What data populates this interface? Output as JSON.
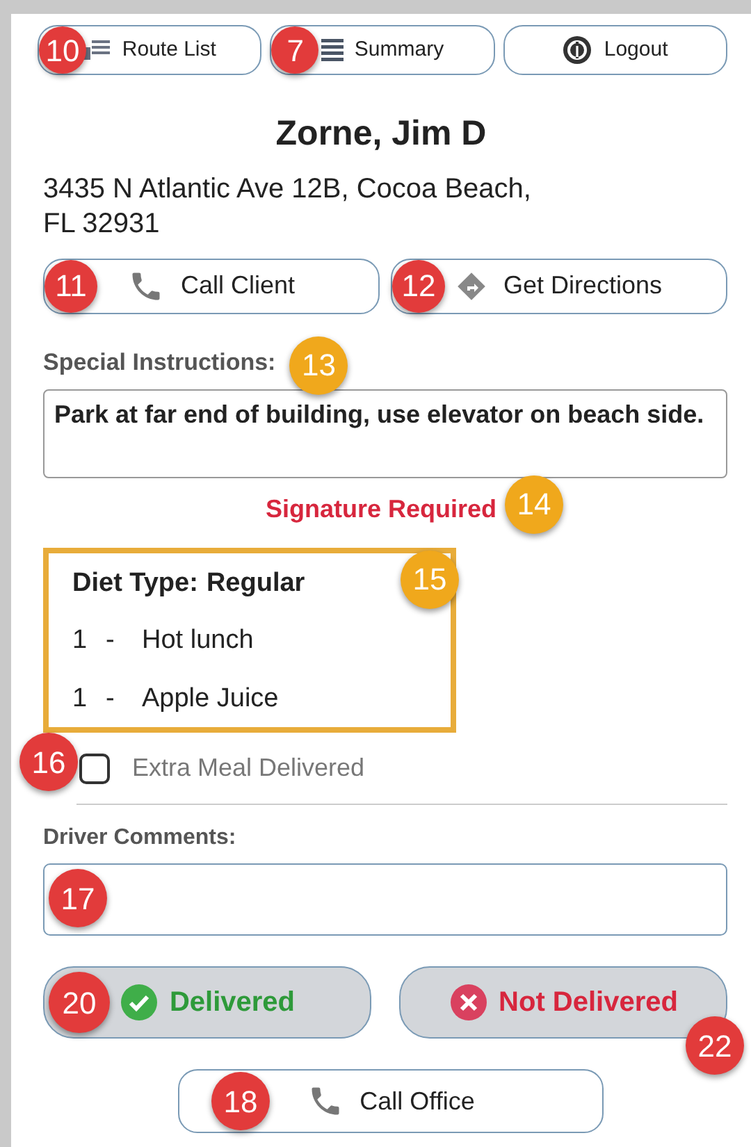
{
  "top_buttons": [
    {
      "kind": "list",
      "label": "Route List",
      "callout": {
        "number": "10",
        "color": "#e23b3b"
      }
    },
    {
      "kind": "summary",
      "label": "Summary",
      "callout": {
        "number": "7",
        "color": "#e23b3b"
      }
    },
    {
      "kind": "logout",
      "label": "Logout"
    }
  ],
  "client": {
    "name": "Zorne, Jim D",
    "address": "3435 N Atlantic Ave 12B, Cocoa Beach, FL 32931"
  },
  "action_buttons": [
    {
      "kind": "phone",
      "label": "Call Client",
      "callout": {
        "number": "11",
        "color": "#e23b3b"
      }
    },
    {
      "kind": "directions",
      "label": "Get Directions",
      "callout": {
        "number": "12",
        "color": "#e23b3b"
      }
    }
  ],
  "special_instructions": {
    "label": "Special Instructions:",
    "text": "Park at far end of building, use elevator on beach side.",
    "callout": {
      "number": "13",
      "color": "#f0a81c"
    }
  },
  "signature": {
    "text": "Signature Required",
    "callout": {
      "number": "14",
      "color": "#f0a81c"
    }
  },
  "meal": {
    "diet_label": "Diet Type:",
    "diet_value": "Regular",
    "callout": {
      "number": "15",
      "color": "#f0a81c"
    },
    "items": [
      {
        "qty": "1",
        "sep": "-",
        "name": "Hot lunch"
      },
      {
        "qty": "1",
        "sep": "-",
        "name": "Apple Juice"
      }
    ]
  },
  "extra_meal": {
    "label": "Extra Meal Delivered",
    "checked": false,
    "callout": {
      "number": "16",
      "color": "#e23b3b"
    }
  },
  "driver_comments": {
    "label": "Driver Comments:",
    "callout": {
      "number": "17",
      "color": "#e23b3b"
    }
  },
  "status_buttons": [
    {
      "kind": "delivered",
      "label": "Delivered",
      "callout": {
        "number": "20",
        "color": "#e23b3b"
      }
    },
    {
      "kind": "not_delivered",
      "label": "Not Delivered",
      "callout": {
        "number": "22",
        "color": "#e23b3b"
      }
    }
  ],
  "call_office": {
    "label": "Call Office",
    "callout": {
      "number": "18",
      "color": "#e23b3b"
    }
  }
}
